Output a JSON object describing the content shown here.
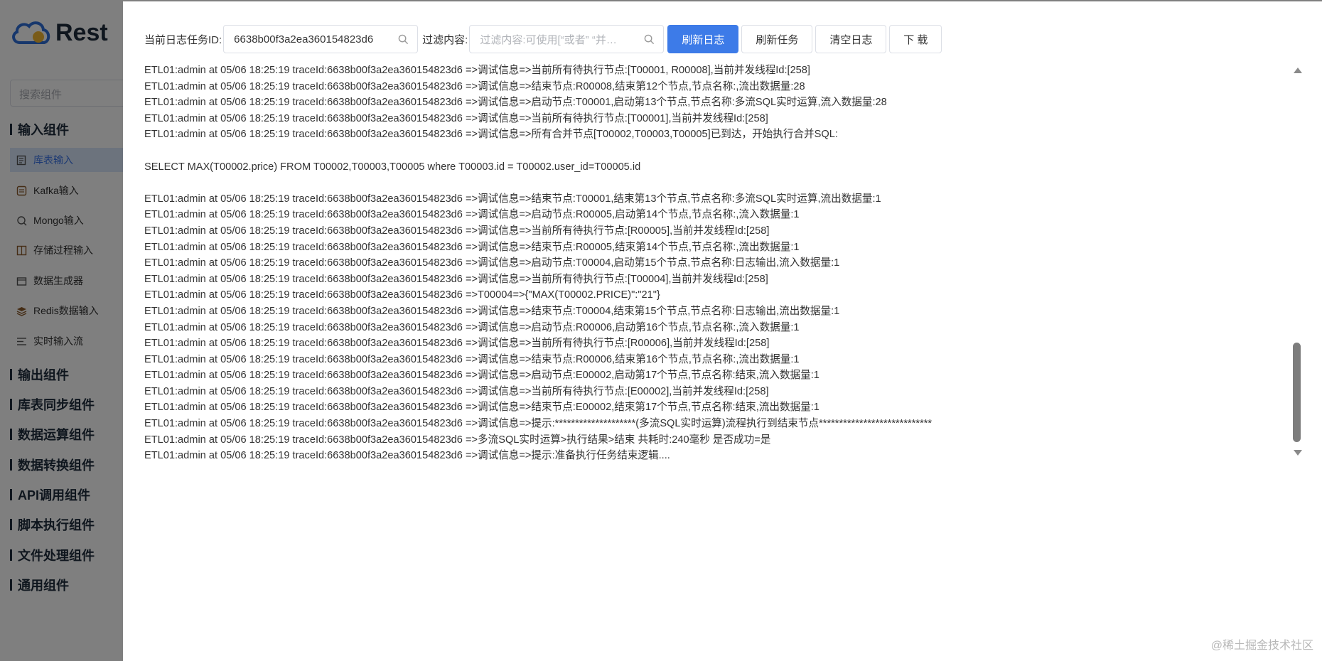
{
  "app": {
    "logo_text": "Rest",
    "search_placeholder": "搜索组件",
    "groups_top": [
      {
        "label": "输入组件"
      }
    ],
    "input_items": [
      {
        "label": "库表输入",
        "icon": "table-input-icon"
      },
      {
        "label": "Kafka输入",
        "icon": "kafka-icon"
      },
      {
        "label": "Mongo输入",
        "icon": "mongo-icon"
      },
      {
        "label": "存储过程输入",
        "icon": "procedure-icon"
      },
      {
        "label": "数据生成器",
        "icon": "generator-icon"
      },
      {
        "label": "Redis数据输入",
        "icon": "redis-icon"
      },
      {
        "label": "实时输入流",
        "icon": "stream-icon"
      }
    ],
    "groups_bottom": [
      {
        "label": "输出组件"
      },
      {
        "label": "库表同步组件"
      },
      {
        "label": "数据运算组件"
      },
      {
        "label": "数据转换组件"
      },
      {
        "label": "API调用组件"
      },
      {
        "label": "脚本执行组件"
      },
      {
        "label": "文件处理组件"
      },
      {
        "label": "通用组件"
      }
    ]
  },
  "toolbar": {
    "task_id_label": "当前日志任务ID:",
    "task_id_value": "6638b00f3a2ea360154823d6",
    "filter_label": "过滤内容:",
    "filter_placeholder": "过滤内容:可使用[“或者” “并…",
    "refresh_log": "刷新日志",
    "refresh_task": "刷新任务",
    "clear_log": "清空日志",
    "download": "下 载"
  },
  "log_lines": [
    "ETL01:admin at 05/06 18:25:19 traceId:6638b00f3a2ea360154823d6 =>调试信息=>当前所有待执行节点:[T00001, R00008],当前并发线程Id:[258]",
    "ETL01:admin at 05/06 18:25:19 traceId:6638b00f3a2ea360154823d6 =>调试信息=>结束节点:R00008,结束第12个节点,节点名称:,流出数据量:28",
    "ETL01:admin at 05/06 18:25:19 traceId:6638b00f3a2ea360154823d6 =>调试信息=>启动节点:T00001,启动第13个节点,节点名称:多流SQL实时运算,流入数据量:28",
    "ETL01:admin at 05/06 18:25:19 traceId:6638b00f3a2ea360154823d6 =>调试信息=>当前所有待执行节点:[T00001],当前并发线程Id:[258]",
    "ETL01:admin at 05/06 18:25:19 traceId:6638b00f3a2ea360154823d6 =>调试信息=>所有合并节点[T00002,T00003,T00005]已到达，开始执行合并SQL:",
    "",
    "SELECT MAX(T00002.price) FROM T00002,T00003,T00005 where T00003.id = T00002.user_id=T00005.id",
    "",
    "ETL01:admin at 05/06 18:25:19 traceId:6638b00f3a2ea360154823d6 =>调试信息=>结束节点:T00001,结束第13个节点,节点名称:多流SQL实时运算,流出数据量:1",
    "ETL01:admin at 05/06 18:25:19 traceId:6638b00f3a2ea360154823d6 =>调试信息=>启动节点:R00005,启动第14个节点,节点名称:,流入数据量:1",
    "ETL01:admin at 05/06 18:25:19 traceId:6638b00f3a2ea360154823d6 =>调试信息=>当前所有待执行节点:[R00005],当前并发线程Id:[258]",
    "ETL01:admin at 05/06 18:25:19 traceId:6638b00f3a2ea360154823d6 =>调试信息=>结束节点:R00005,结束第14个节点,节点名称:,流出数据量:1",
    "ETL01:admin at 05/06 18:25:19 traceId:6638b00f3a2ea360154823d6 =>调试信息=>启动节点:T00004,启动第15个节点,节点名称:日志输出,流入数据量:1",
    "ETL01:admin at 05/06 18:25:19 traceId:6638b00f3a2ea360154823d6 =>调试信息=>当前所有待执行节点:[T00004],当前并发线程Id:[258]",
    "ETL01:admin at 05/06 18:25:19 traceId:6638b00f3a2ea360154823d6 =>T00004=>{\"MAX(T00002.PRICE)\":\"21\"}",
    "ETL01:admin at 05/06 18:25:19 traceId:6638b00f3a2ea360154823d6 =>调试信息=>结束节点:T00004,结束第15个节点,节点名称:日志输出,流出数据量:1",
    "ETL01:admin at 05/06 18:25:19 traceId:6638b00f3a2ea360154823d6 =>调试信息=>启动节点:R00006,启动第16个节点,节点名称:,流入数据量:1",
    "ETL01:admin at 05/06 18:25:19 traceId:6638b00f3a2ea360154823d6 =>调试信息=>当前所有待执行节点:[R00006],当前并发线程Id:[258]",
    "ETL01:admin at 05/06 18:25:19 traceId:6638b00f3a2ea360154823d6 =>调试信息=>结束节点:R00006,结束第16个节点,节点名称:,流出数据量:1",
    "ETL01:admin at 05/06 18:25:19 traceId:6638b00f3a2ea360154823d6 =>调试信息=>启动节点:E00002,启动第17个节点,节点名称:结束,流入数据量:1",
    "ETL01:admin at 05/06 18:25:19 traceId:6638b00f3a2ea360154823d6 =>调试信息=>当前所有待执行节点:[E00002],当前并发线程Id:[258]",
    "ETL01:admin at 05/06 18:25:19 traceId:6638b00f3a2ea360154823d6 =>调试信息=>结束节点:E00002,结束第17个节点,节点名称:结束,流出数据量:1",
    "ETL01:admin at 05/06 18:25:19 traceId:6638b00f3a2ea360154823d6 =>调试信息=>提示:********************(多流SQL实时运算)流程执行到结束节点****************************",
    "ETL01:admin at 05/06 18:25:19 traceId:6638b00f3a2ea360154823d6 =>多流SQL实时运算>执行结果>结束 共耗时:240毫秒 是否成功=是",
    "ETL01:admin at 05/06 18:25:19 traceId:6638b00f3a2ea360154823d6 =>调试信息=>提示:准备执行任务结束逻辑...."
  ],
  "watermark": "@稀土掘金技术社区",
  "colors": {
    "primary": "#3d7be8",
    "overlay": "rgba(0,0,0,0.5)"
  }
}
